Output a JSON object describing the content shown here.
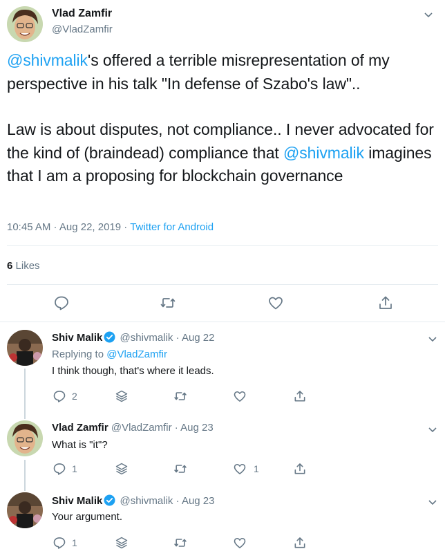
{
  "main_tweet": {
    "author_name": "Vlad Zamfir",
    "author_handle": "@VladZamfir",
    "text_p1_mention": "@shivmalik",
    "text_p1_rest": "'s offered a terrible misrepresentation of my perspective in his talk \"In defense of Szabo's law\"..",
    "text_p2_a": "Law is about disputes, not compliance.. I never advocated for the kind of (braindead) compliance that ",
    "text_p2_mention": "@shivmalik",
    "text_p2_b": " imagines that I am a proposing for blockchain governance",
    "timestamp": "10:45 AM · Aug 22, 2019 · ",
    "source": "Twitter for Android",
    "likes_count": "6",
    "likes_label": "Likes",
    "actions": [
      "reply-icon",
      "retweet-icon",
      "like-icon",
      "share-icon"
    ]
  },
  "replies": [
    {
      "name": "Shiv Malik",
      "verified": true,
      "handle": "@shivmalik",
      "date": "· Aug 22",
      "replying_to_label": "Replying to ",
      "replying_to_handle": "@VladZamfir",
      "text": "I think though, that's where it leads.",
      "reply_count": "2",
      "like_count": ""
    },
    {
      "name": "Vlad Zamfir",
      "verified": false,
      "handle": "@VladZamfir",
      "date": "· Aug 23",
      "text": "What is \"it\"?",
      "reply_count": "1",
      "like_count": "1"
    },
    {
      "name": "Shiv Malik",
      "verified": true,
      "handle": "@shivmalik",
      "date": "· Aug 23",
      "text": "Your argument.",
      "reply_count": "1",
      "like_count": ""
    }
  ],
  "colors": {
    "accent": "#1da1f2",
    "secondary_text": "#657786",
    "primary_text": "#14171a",
    "border": "#e6ecf0",
    "thread_line": "#ccd6dd"
  }
}
